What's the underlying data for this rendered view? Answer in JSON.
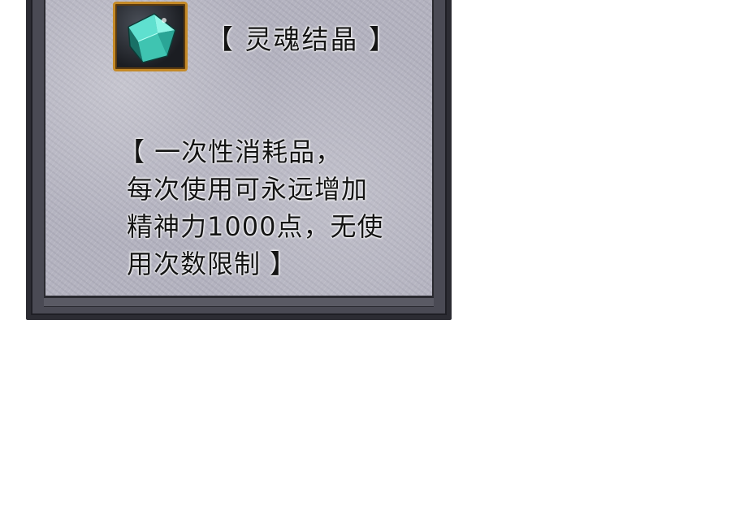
{
  "item": {
    "icon": "soul-crystal-icon",
    "name": "【 灵魂结晶 】",
    "description_lines": [
      "【 一次性消耗品，",
      "每次使用可永远增加",
      "精神力1000点，无使",
      "用次数限制 】"
    ]
  },
  "colors": {
    "panel_background": "#b4b3c0",
    "frame": "#2c2c33",
    "icon_border": "#c48a28",
    "crystal": "#3fb8a8",
    "text": "#141414",
    "page_background": "#ffffff"
  }
}
